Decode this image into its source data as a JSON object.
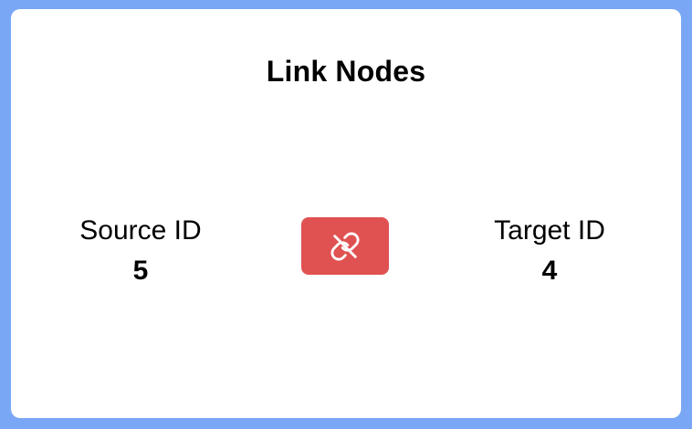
{
  "panel": {
    "title": "Link Nodes"
  },
  "source": {
    "label": "Source ID",
    "value": "5"
  },
  "target": {
    "label": "Target ID",
    "value": "4"
  },
  "unlink_button": {
    "icon": "unlink-icon",
    "color": "#e05252"
  },
  "colors": {
    "background": "#7aa7f5",
    "panel": "#ffffff"
  }
}
